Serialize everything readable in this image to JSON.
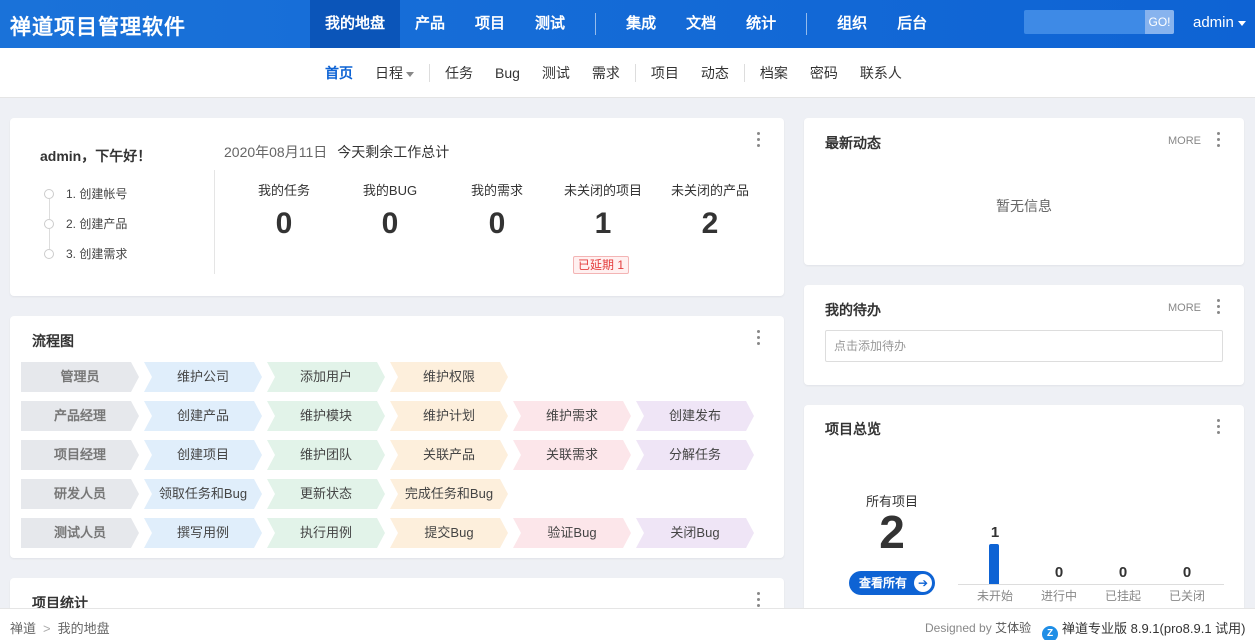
{
  "app": {
    "brand": "禅道项目管理软件"
  },
  "mainnav": [
    {
      "label": "我的地盘"
    },
    {
      "label": "产品"
    },
    {
      "label": "项目"
    },
    {
      "label": "测试"
    },
    {
      "label": "集成"
    },
    {
      "label": "文档"
    },
    {
      "label": "统计"
    },
    {
      "label": "组织"
    },
    {
      "label": "后台"
    }
  ],
  "search": {
    "value": "",
    "go_label": "GO!"
  },
  "user": {
    "name": "admin"
  },
  "subnav": [
    {
      "label": "首页"
    },
    {
      "label": "日程"
    },
    {
      "label": "任务"
    },
    {
      "label": "Bug"
    },
    {
      "label": "测试"
    },
    {
      "label": "需求"
    },
    {
      "label": "项目"
    },
    {
      "label": "动态"
    },
    {
      "label": "档案"
    },
    {
      "label": "密码"
    },
    {
      "label": "联系人"
    }
  ],
  "welcome": {
    "greeting": "admin，下午好！",
    "date": "2020年08月11日",
    "summary": "今天剩余工作总计",
    "steps": [
      "1. 创建帐号",
      "2. 创建产品",
      "3. 创建需求"
    ],
    "stats": [
      {
        "label": "我的任务",
        "value": "0"
      },
      {
        "label": "我的BUG",
        "value": "0"
      },
      {
        "label": "我的需求",
        "value": "0"
      },
      {
        "label": "未关闭的项目",
        "value": "1"
      },
      {
        "label": "未关闭的产品",
        "value": "2"
      }
    ],
    "delayed": "已延期 1"
  },
  "flow": {
    "title": "流程图",
    "rows": [
      {
        "role": "管理员",
        "steps": [
          "维护公司",
          "添加用户",
          "维护权限"
        ]
      },
      {
        "role": "产品经理",
        "steps": [
          "创建产品",
          "维护模块",
          "维护计划",
          "维护需求",
          "创建发布"
        ]
      },
      {
        "role": "项目经理",
        "steps": [
          "创建项目",
          "维护团队",
          "关联产品",
          "关联需求",
          "分解任务"
        ]
      },
      {
        "role": "研发人员",
        "steps": [
          "领取任务和Bug",
          "更新状态",
          "完成任务和Bug"
        ]
      },
      {
        "role": "测试人员",
        "steps": [
          "撰写用例",
          "执行用例",
          "提交Bug",
          "验证Bug",
          "关闭Bug"
        ]
      }
    ]
  },
  "project_stats": {
    "title": "项目统计"
  },
  "dynamics": {
    "title": "最新动态",
    "more": "MORE",
    "empty": "暂无信息"
  },
  "todo": {
    "title": "我的待办",
    "more": "MORE",
    "placeholder": "点击添加待办"
  },
  "overview": {
    "title": "项目总览",
    "all_label": "所有项目",
    "all_count": "2",
    "view_all": "查看所有",
    "bars": [
      {
        "label": "未开始",
        "value": 1
      },
      {
        "label": "进行中",
        "value": 0
      },
      {
        "label": "已挂起",
        "value": 0
      },
      {
        "label": "已关闭",
        "value": 0
      }
    ]
  },
  "footer": {
    "crumbs": [
      "禅道",
      "我的地盘"
    ],
    "designed_by": "Designed by",
    "designer": "艾体验",
    "version": "禅道专业版 8.9.1(pro8.9.1 试用)"
  }
}
